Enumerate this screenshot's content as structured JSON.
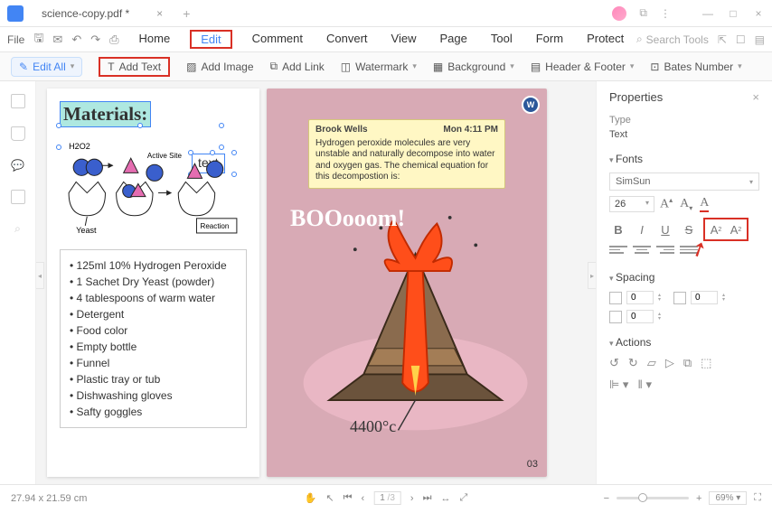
{
  "title_bar": {
    "filename": "science-copy.pdf *"
  },
  "menus": {
    "file": "File",
    "tabs": [
      "Home",
      "Edit",
      "Comment",
      "Convert",
      "View",
      "Page",
      "Tool",
      "Form",
      "Protect"
    ],
    "active_tab": "Edit",
    "search_placeholder": "Search Tools"
  },
  "toolbar": {
    "edit_all": "Edit All",
    "add_text": "Add Text",
    "add_image": "Add Image",
    "add_link": "Add Link",
    "watermark": "Watermark",
    "background": "Background",
    "header_footer": "Header & Footer",
    "bates": "Bates Number"
  },
  "left_page": {
    "heading": "Materials:",
    "textbox": "text",
    "diagram": {
      "h202": "H2O2",
      "active_site": "Active Site",
      "yeast": "Yeast",
      "reaction": "Reaction"
    },
    "materials": [
      "125ml 10% Hydrogen Peroxide",
      "1 Sachet Dry Yeast (powder)",
      "4 tablespoons of warm water",
      "Detergent",
      "Food color",
      "Empty bottle",
      "Funnel",
      "Plastic tray or tub",
      "Dishwashing gloves",
      "Safty goggles"
    ]
  },
  "right_page": {
    "comment": {
      "author": "Brook Wells",
      "time": "Mon 4:11 PM",
      "body": "Hydrogen peroxide molecules are very unstable and naturally decompose into water and oxygen gas. The chemical equation for this decompostion is:"
    },
    "boom": "BOOooom!",
    "temp": "4400°c",
    "page_num": "03"
  },
  "properties": {
    "title": "Properties",
    "type_label": "Type",
    "type_value": "Text",
    "fonts_hdr": "Fonts",
    "font_family": "SimSun",
    "font_size": "26",
    "spacing_hdr": "Spacing",
    "sp0": "0",
    "sp1": "0",
    "sp2": "0",
    "actions_hdr": "Actions"
  },
  "status": {
    "dimensions": "27.94 x 21.59 cm",
    "page": "1",
    "total": "/3",
    "zoom": "69%"
  }
}
